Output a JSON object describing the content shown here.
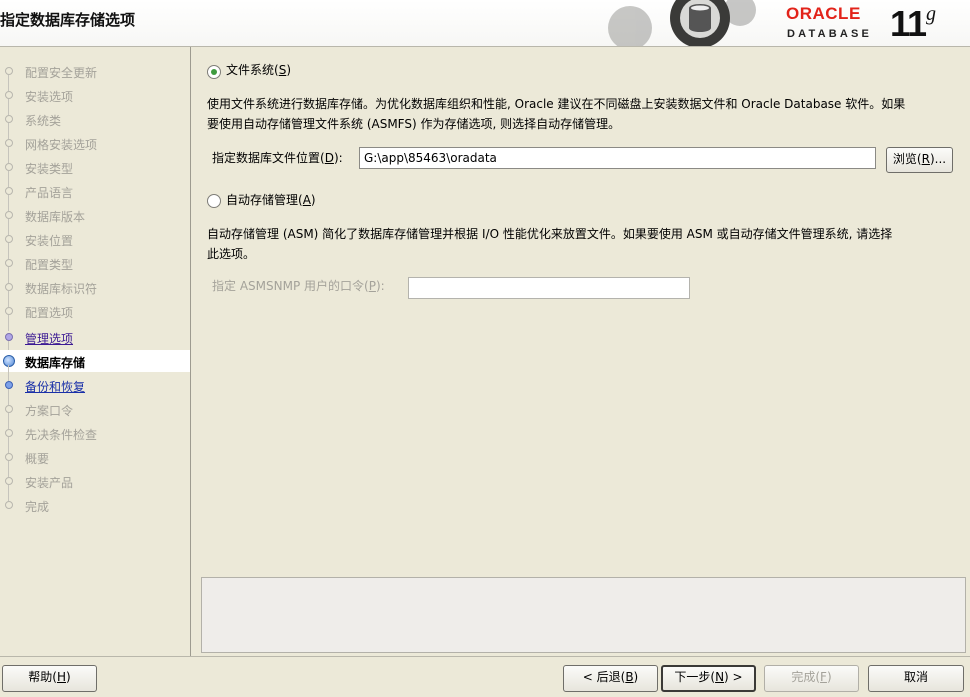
{
  "window": {
    "title": "指定数据库存储选项"
  },
  "branding": {
    "vendor": "ORACLE",
    "product": "DATABASE",
    "version": "11",
    "version_suffix": "g",
    "oracle_red": "#e2231a"
  },
  "nav": {
    "steps": [
      {
        "label": "配置安全更新",
        "state": "done"
      },
      {
        "label": "安装选项",
        "state": "done"
      },
      {
        "label": "系统类",
        "state": "done"
      },
      {
        "label": "网格安装选项",
        "state": "done"
      },
      {
        "label": "安装类型",
        "state": "done"
      },
      {
        "label": "产品语言",
        "state": "done"
      },
      {
        "label": "数据库版本",
        "state": "done"
      },
      {
        "label": "安装位置",
        "state": "done"
      },
      {
        "label": "配置类型",
        "state": "done"
      },
      {
        "label": "数据库标识符",
        "state": "done"
      },
      {
        "label": "配置选项",
        "state": "done"
      },
      {
        "label": "管理选项",
        "state": "link"
      },
      {
        "label": "数据库存储",
        "state": "current"
      },
      {
        "label": "备份和恢复",
        "state": "link"
      },
      {
        "label": "方案口令",
        "state": "pending"
      },
      {
        "label": "先决条件检查",
        "state": "pending"
      },
      {
        "label": "概要",
        "state": "pending"
      },
      {
        "label": "安装产品",
        "state": "pending"
      },
      {
        "label": "完成",
        "state": "pending"
      }
    ]
  },
  "filesystem": {
    "radio_label": "文件系统(",
    "radio_mnemonic": "S",
    "radio_suffix": ")",
    "selected": true,
    "description_line1": "使用文件系统进行数据库存储。为优化数据库组织和性能, Oracle 建议在不同磁盘上安装数据文件和 Oracle Database 软件。如果",
    "description_line2": "要使用自动存储管理文件系统 (ASMFS) 作为存储选项, 则选择自动存储管理。",
    "location_label": "指定数据库文件位置(",
    "location_mnemonic": "D",
    "location_suffix": "):",
    "location_value": "G:\\app\\85463\\oradata",
    "browse_label": "浏览(",
    "browse_mnemonic": "R",
    "browse_suffix": ")..."
  },
  "asm": {
    "radio_label": "自动存储管理(",
    "radio_mnemonic": "A",
    "radio_suffix": ")",
    "selected": false,
    "description_line1": "自动存储管理 (ASM) 简化了数据库存储管理并根据 I/O 性能优化来放置文件。如果要使用 ASM 或自动存储文件管理系统, 请选择",
    "description_line2": "此选项。",
    "password_label": "指定 ASMSNMP 用户的口令(",
    "password_mnemonic": "P",
    "password_suffix": "):",
    "password_value": ""
  },
  "footer": {
    "help_label": "帮助(",
    "help_mnemonic": "H",
    "help_suffix": ")",
    "back_label": "< 后退(",
    "back_mnemonic": "B",
    "back_suffix": ")",
    "next_label": "下一步(",
    "next_mnemonic": "N",
    "next_suffix": ") >",
    "finish_label": "完成(",
    "finish_mnemonic": "F",
    "finish_suffix": ")",
    "cancel_label": "取消"
  }
}
